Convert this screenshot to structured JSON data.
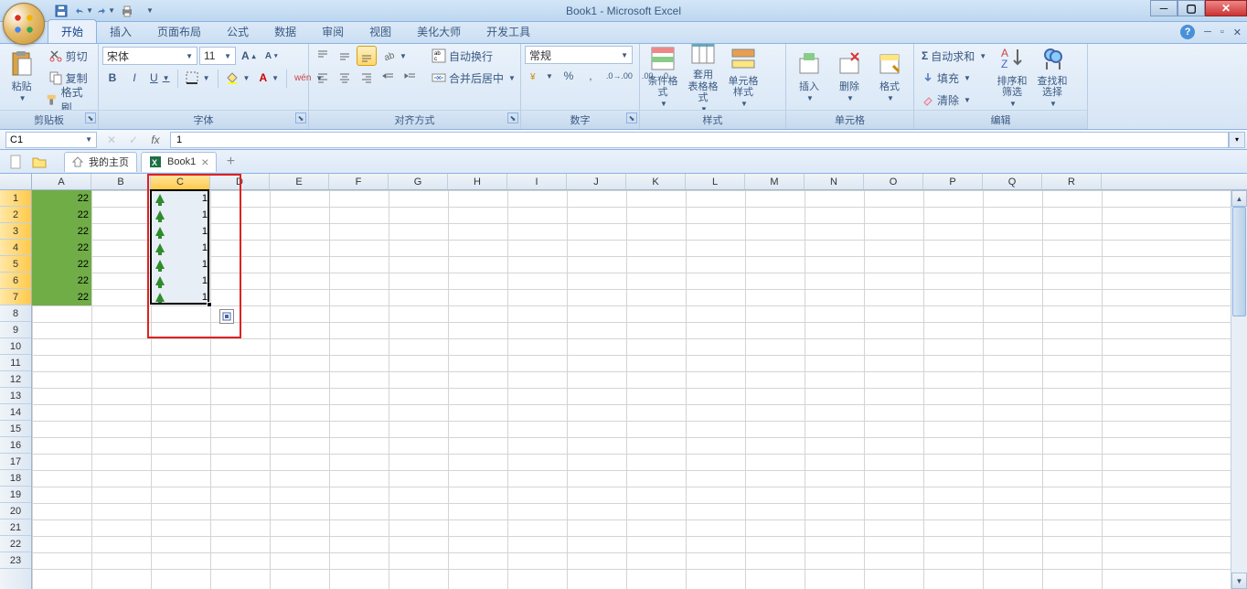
{
  "title": "Book1 - Microsoft Excel",
  "qat": [
    "save",
    "undo",
    "print",
    "preview",
    "new"
  ],
  "tabs": [
    "开始",
    "插入",
    "页面布局",
    "公式",
    "数据",
    "审阅",
    "视图",
    "美化大师",
    "开发工具"
  ],
  "active_tab": 0,
  "ribbon": {
    "clipboard": {
      "label": "剪贴板",
      "paste": "粘贴",
      "cut": "剪切",
      "copy": "复制",
      "brush": "格式刷"
    },
    "font": {
      "label": "字体",
      "name": "宋体",
      "size": "11"
    },
    "align": {
      "label": "对齐方式",
      "wrap": "自动换行",
      "merge": "合并后居中"
    },
    "number": {
      "label": "数字",
      "format": "常规"
    },
    "styles": {
      "label": "样式",
      "cond": "条件格式",
      "table": "套用\n表格格式",
      "cell": "单元格\n样式"
    },
    "cells": {
      "label": "单元格",
      "insert": "插入",
      "delete": "删除",
      "format": "格式"
    },
    "editing": {
      "label": "编辑",
      "sum": "自动求和",
      "fill": "填充",
      "clear": "清除",
      "sort": "排序和\n筛选",
      "find": "查找和\n选择"
    }
  },
  "namebox": "C1",
  "formula": "1",
  "fx_label": "fx",
  "doctabs": {
    "home": "我的主页",
    "book": "Book1"
  },
  "columns": [
    "A",
    "B",
    "C",
    "D",
    "E",
    "F",
    "G",
    "H",
    "I",
    "J",
    "K",
    "L",
    "M",
    "N",
    "O",
    "P",
    "Q",
    "R"
  ],
  "rows": 23,
  "colA_values": [
    "22",
    "22",
    "22",
    "22",
    "22",
    "22",
    "22"
  ],
  "colC_values": [
    "1",
    "1",
    "1",
    "1",
    "1",
    "1",
    "1"
  ],
  "selected_range": {
    "col": 2,
    "row_start": 0,
    "row_end": 6
  },
  "red_highlight": {
    "col": 2,
    "row_start": 0,
    "row_end": 8
  }
}
